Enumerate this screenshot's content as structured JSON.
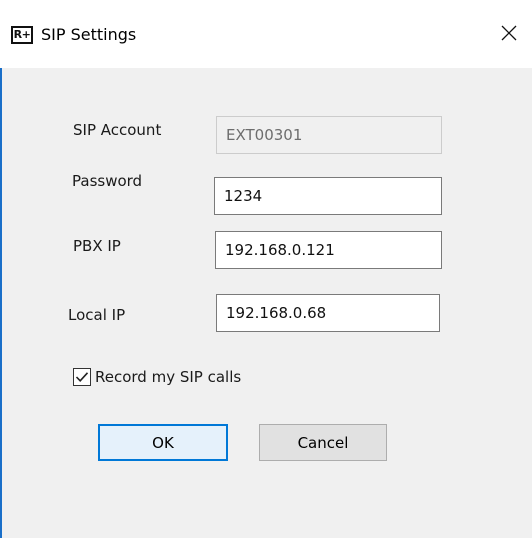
{
  "window": {
    "title": "SIP Settings",
    "icon_text": "R+",
    "close_glyph": "close-icon"
  },
  "form": {
    "sip_account_label": "SIP Account",
    "sip_account_value": "EXT00301",
    "password_label": "Password",
    "password_value": "1234",
    "pbx_ip_label": "PBX IP",
    "pbx_ip_value": "192.168.0.121",
    "local_ip_label": "Local IP",
    "local_ip_value": "192.168.0.68",
    "record_calls_label": "Record my SIP calls",
    "record_calls_checked": true
  },
  "buttons": {
    "ok_label": "OK",
    "cancel_label": "Cancel"
  },
  "colors": {
    "accent": "#0078d7",
    "window_border": "#1a6fc9"
  }
}
